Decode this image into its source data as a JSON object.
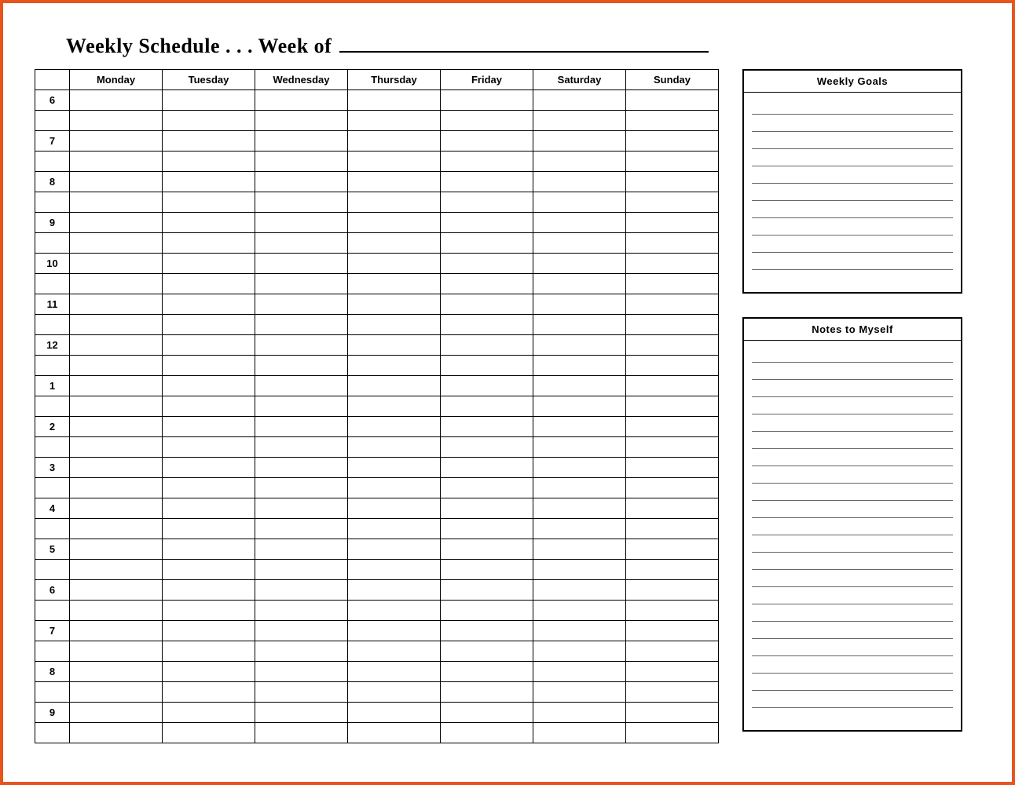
{
  "title": {
    "prefix": "Weekly Schedule . . . Week of",
    "week_of_value": ""
  },
  "schedule": {
    "time_header": "",
    "days": [
      "Monday",
      "Tuesday",
      "Wednesday",
      "Thursday",
      "Friday",
      "Saturday",
      "Sunday"
    ],
    "hours": [
      "6",
      "7",
      "8",
      "9",
      "10",
      "11",
      "12",
      "1",
      "2",
      "3",
      "4",
      "5",
      "6",
      "7",
      "8",
      "9"
    ],
    "subrows_per_hour": 2
  },
  "goals": {
    "header": "Weekly Goals",
    "line_count": 11
  },
  "notes": {
    "header": "Notes to Myself",
    "line_count": 22
  }
}
